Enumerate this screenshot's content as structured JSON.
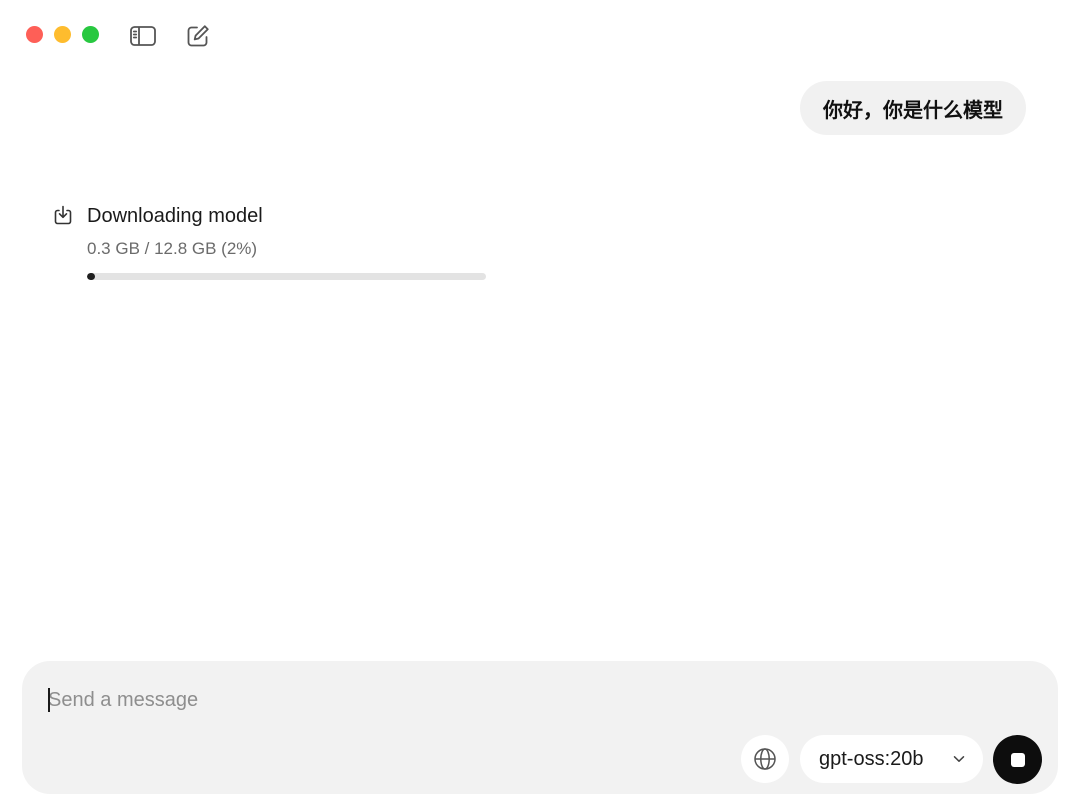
{
  "window": {
    "controls": [
      "close",
      "minimize",
      "zoom"
    ]
  },
  "toolbar": {
    "sidebar_icon": "sidebar-toggle-icon",
    "compose_icon": "new-chat-icon"
  },
  "conversation": {
    "user_message": "你好，你是什么模型",
    "download": {
      "icon": "download-icon",
      "title": "Downloading model",
      "status": "0.3 GB / 12.8 GB (2%)",
      "progress_fraction": 0.02
    }
  },
  "composer": {
    "placeholder": "Send a message",
    "value": "",
    "web_icon": "globe-icon",
    "model": "gpt-oss:20b",
    "model_chevron_icon": "chevron-down-icon",
    "stop_icon": "stop-icon"
  },
  "colors": {
    "bubble_bg": "#f1f1f1",
    "composer_bg": "#f2f2f2",
    "progress_fill": "#1f1f1f",
    "progress_track": "#e3e3e3",
    "close": "#fe5f57",
    "minimize": "#febc2e",
    "zoom": "#28c840"
  }
}
